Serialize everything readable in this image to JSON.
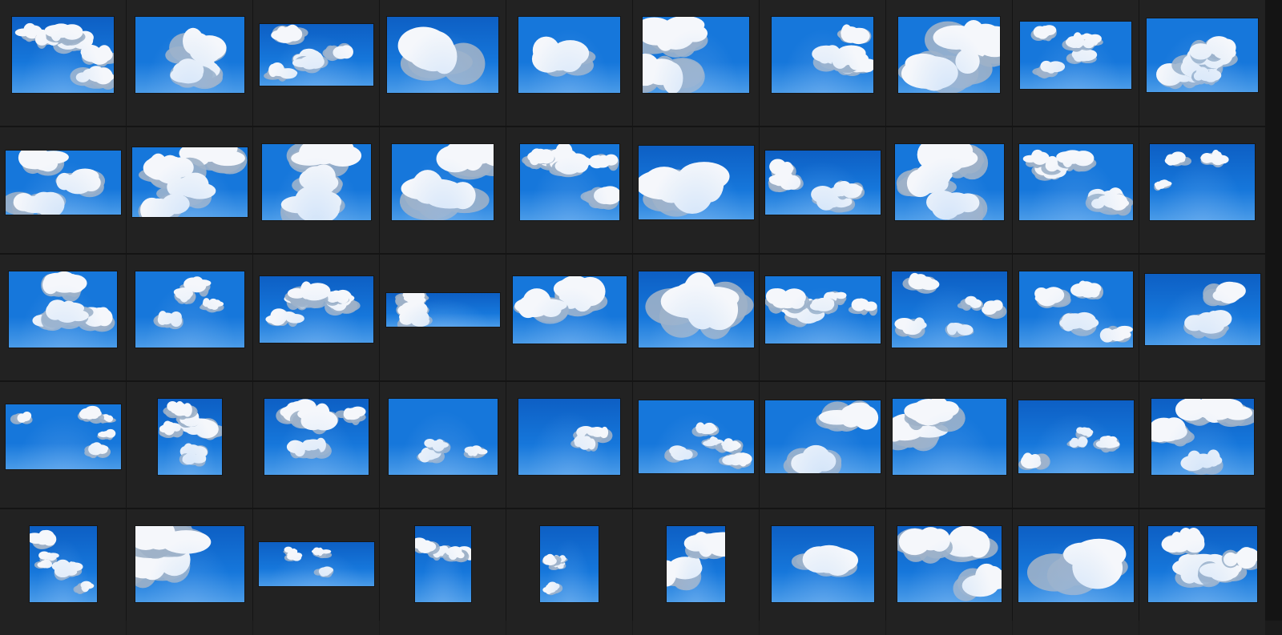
{
  "gallery": {
    "columns": 10,
    "rows": 5,
    "palette": {
      "background": "#1b1b1b",
      "cell": "#222222",
      "sky_dark": "#0d5fc4",
      "sky_mid": "#1677db",
      "sky_light": "#4a9be8",
      "cloud": "#f5f7fb",
      "cloud_shadow": "#9fb1c8"
    },
    "items": [
      {
        "r": 0,
        "c": 0,
        "w": 0.82,
        "h": 0.62,
        "seed": 3,
        "clouds": "scattered"
      },
      {
        "r": 0,
        "c": 1,
        "w": 0.88,
        "h": 0.62,
        "seed": 5,
        "clouds": "pair"
      },
      {
        "r": 0,
        "c": 2,
        "w": 0.92,
        "h": 0.5,
        "seed": 8,
        "clouds": "scattered"
      },
      {
        "r": 0,
        "c": 3,
        "w": 0.9,
        "h": 0.62,
        "seed": 2,
        "clouds": "single-large"
      },
      {
        "r": 0,
        "c": 4,
        "w": 0.82,
        "h": 0.62,
        "seed": 11,
        "clouds": "single"
      },
      {
        "r": 0,
        "c": 5,
        "w": 0.86,
        "h": 0.62,
        "seed": 13,
        "clouds": "single"
      },
      {
        "r": 0,
        "c": 6,
        "w": 0.82,
        "h": 0.62,
        "seed": 17,
        "clouds": "scattered"
      },
      {
        "r": 0,
        "c": 7,
        "w": 0.82,
        "h": 0.62,
        "seed": 19,
        "clouds": "single"
      },
      {
        "r": 0,
        "c": 8,
        "w": 0.9,
        "h": 0.55,
        "seed": 23,
        "clouds": "small"
      },
      {
        "r": 0,
        "c": 9,
        "w": 0.9,
        "h": 0.6,
        "seed": 29,
        "clouds": "scattered"
      },
      {
        "r": 1,
        "c": 0,
        "w": 0.93,
        "h": 0.52,
        "seed": 31,
        "clouds": "layer"
      },
      {
        "r": 1,
        "c": 1,
        "w": 0.93,
        "h": 0.57,
        "seed": 37,
        "clouds": "layer"
      },
      {
        "r": 1,
        "c": 2,
        "w": 0.88,
        "h": 0.62,
        "seed": 41,
        "clouds": "layer"
      },
      {
        "r": 1,
        "c": 3,
        "w": 0.82,
        "h": 0.62,
        "seed": 43,
        "clouds": "single"
      },
      {
        "r": 1,
        "c": 4,
        "w": 0.8,
        "h": 0.62,
        "seed": 47,
        "clouds": "scattered"
      },
      {
        "r": 1,
        "c": 5,
        "w": 0.93,
        "h": 0.6,
        "seed": 53,
        "clouds": "single-large"
      },
      {
        "r": 1,
        "c": 6,
        "w": 0.93,
        "h": 0.52,
        "seed": 59,
        "clouds": "scattered"
      },
      {
        "r": 1,
        "c": 7,
        "w": 0.88,
        "h": 0.62,
        "seed": 61,
        "clouds": "layer"
      },
      {
        "r": 1,
        "c": 8,
        "w": 0.92,
        "h": 0.62,
        "seed": 67,
        "clouds": "scattered"
      },
      {
        "r": 1,
        "c": 9,
        "w": 0.85,
        "h": 0.62,
        "seed": 71,
        "clouds": "small"
      },
      {
        "r": 2,
        "c": 0,
        "w": 0.87,
        "h": 0.62,
        "seed": 73,
        "clouds": "scattered"
      },
      {
        "r": 2,
        "c": 1,
        "w": 0.88,
        "h": 0.62,
        "seed": 79,
        "clouds": "small"
      },
      {
        "r": 2,
        "c": 2,
        "w": 0.92,
        "h": 0.54,
        "seed": 83,
        "clouds": "scattered"
      },
      {
        "r": 2,
        "c": 3,
        "w": 0.92,
        "h": 0.28,
        "seed": 89,
        "clouds": "layer"
      },
      {
        "r": 2,
        "c": 4,
        "w": 0.92,
        "h": 0.55,
        "seed": 97,
        "clouds": "single"
      },
      {
        "r": 2,
        "c": 5,
        "w": 0.93,
        "h": 0.62,
        "seed": 101,
        "clouds": "single-large"
      },
      {
        "r": 2,
        "c": 6,
        "w": 0.93,
        "h": 0.55,
        "seed": 103,
        "clouds": "scattered"
      },
      {
        "r": 2,
        "c": 7,
        "w": 0.93,
        "h": 0.62,
        "seed": 107,
        "clouds": "small"
      },
      {
        "r": 2,
        "c": 8,
        "w": 0.92,
        "h": 0.62,
        "seed": 109,
        "clouds": "scattered"
      },
      {
        "r": 2,
        "c": 9,
        "w": 0.93,
        "h": 0.58,
        "seed": 113,
        "clouds": "pair"
      },
      {
        "r": 3,
        "c": 0,
        "w": 0.93,
        "h": 0.53,
        "seed": 127,
        "clouds": "small"
      },
      {
        "r": 3,
        "c": 1,
        "w": 0.52,
        "h": 0.62,
        "seed": 131,
        "clouds": "scattered"
      },
      {
        "r": 3,
        "c": 2,
        "w": 0.84,
        "h": 0.62,
        "seed": 137,
        "clouds": "scattered"
      },
      {
        "r": 3,
        "c": 3,
        "w": 0.88,
        "h": 0.62,
        "seed": 139,
        "clouds": "small"
      },
      {
        "r": 3,
        "c": 4,
        "w": 0.82,
        "h": 0.62,
        "seed": 149,
        "clouds": "small"
      },
      {
        "r": 3,
        "c": 5,
        "w": 0.93,
        "h": 0.59,
        "seed": 151,
        "clouds": "small"
      },
      {
        "r": 3,
        "c": 6,
        "w": 0.93,
        "h": 0.59,
        "seed": 157,
        "clouds": "pair"
      },
      {
        "r": 3,
        "c": 7,
        "w": 0.92,
        "h": 0.62,
        "seed": 163,
        "clouds": "pair"
      },
      {
        "r": 3,
        "c": 8,
        "w": 0.93,
        "h": 0.59,
        "seed": 167,
        "clouds": "small"
      },
      {
        "r": 3,
        "c": 9,
        "w": 0.83,
        "h": 0.62,
        "seed": 173,
        "clouds": "scattered"
      },
      {
        "r": 4,
        "c": 0,
        "w": 0.55,
        "h": 0.62,
        "seed": 179,
        "clouds": "small"
      },
      {
        "r": 4,
        "c": 1,
        "w": 0.88,
        "h": 0.62,
        "seed": 181,
        "clouds": "single"
      },
      {
        "r": 4,
        "c": 2,
        "w": 0.93,
        "h": 0.36,
        "seed": 191,
        "clouds": "small"
      },
      {
        "r": 4,
        "c": 3,
        "w": 0.46,
        "h": 0.62,
        "seed": 193,
        "clouds": "scattered"
      },
      {
        "r": 4,
        "c": 4,
        "w": 0.48,
        "h": 0.62,
        "seed": 197,
        "clouds": "small"
      },
      {
        "r": 4,
        "c": 5,
        "w": 0.48,
        "h": 0.62,
        "seed": 199,
        "clouds": "single"
      },
      {
        "r": 4,
        "c": 6,
        "w": 0.83,
        "h": 0.62,
        "seed": 211,
        "clouds": "single"
      },
      {
        "r": 4,
        "c": 7,
        "w": 0.84,
        "h": 0.62,
        "seed": 223,
        "clouds": "pair"
      },
      {
        "r": 4,
        "c": 8,
        "w": 0.93,
        "h": 0.62,
        "seed": 227,
        "clouds": "single-large"
      },
      {
        "r": 4,
        "c": 9,
        "w": 0.88,
        "h": 0.62,
        "seed": 229,
        "clouds": "scattered"
      }
    ]
  }
}
